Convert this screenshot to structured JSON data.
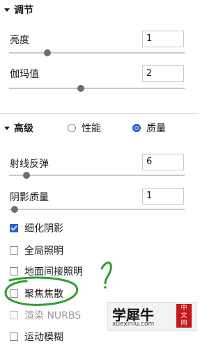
{
  "adjust": {
    "title": "调节",
    "brightness": {
      "label": "亮度",
      "value": "1",
      "slider": 0.22
    },
    "gamma": {
      "label": "伽玛值",
      "value": "2",
      "slider": 0.41
    }
  },
  "advanced": {
    "title": "高级",
    "radio_performance": "性能",
    "radio_quality": "质量",
    "selected_mode": "质量",
    "ray_bounce": {
      "label": "射线反弹",
      "value": "6",
      "slider": 0.1
    },
    "shadow_quality": {
      "label": "阴影质量",
      "value": "1",
      "slider": 0.03
    },
    "checks": [
      {
        "label": "细化阴影",
        "checked": true,
        "disabled": false
      },
      {
        "label": "全局照明",
        "checked": false,
        "disabled": false
      },
      {
        "label": "地面间接照明",
        "checked": false,
        "disabled": false
      },
      {
        "label": "聚焦焦散",
        "checked": false,
        "disabled": false
      },
      {
        "label": "渲染 NURBS",
        "checked": false,
        "disabled": true
      },
      {
        "label": "运动模糊",
        "checked": false,
        "disabled": false
      }
    ]
  },
  "watermark": {
    "brand": "学犀牛",
    "domain": "xuexiniu.com",
    "badge": "中文网"
  },
  "colors": {
    "accent": "#2a62c9",
    "annotation": "#2f9e2f",
    "watermark_red": "#c8161d"
  }
}
